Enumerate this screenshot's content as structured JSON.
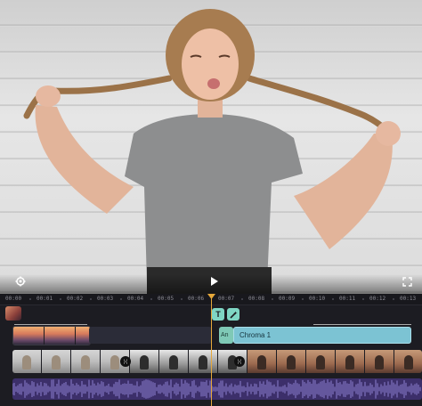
{
  "preview": {
    "settings_icon": "gear-icon",
    "play_icon": "play-icon",
    "fullscreen_icon": "fullscreen-icon"
  },
  "timeline": {
    "ruler_labels": [
      "00:00",
      "00:01",
      "00:02",
      "00:03",
      "00:04",
      "00:05",
      "00:06",
      "00:07",
      "00:08",
      "00:09",
      "00:10",
      "00:11",
      "00:12",
      "00:13"
    ],
    "playhead_time": "00:07",
    "text_tool_label": "T",
    "effect_tool_icon": "magic-wand-icon",
    "clips": {
      "an_label": "An",
      "chroma_label": "Chroma 1"
    },
    "transition_label": "⟩⟨",
    "colors": {
      "playhead": "#e6a83a",
      "text_pill": "#7fd6c4",
      "effect_pill": "#7fd6c4",
      "chroma_clip": "#7cc3d3",
      "audio_clip": "#3c2f6a"
    }
  }
}
